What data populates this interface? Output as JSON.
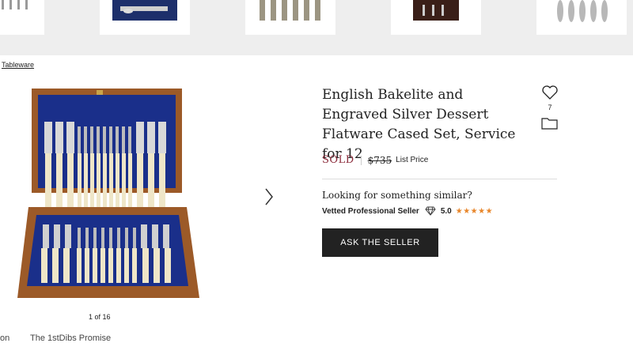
{
  "breadcrumb": "Tableware",
  "product": {
    "title": "English Bakelite and Engraved Silver Dessert Flatware Cased Set, Service for 12",
    "status": "SOLD",
    "price": "$735",
    "price_label": "List Price"
  },
  "favorites": {
    "count": "7"
  },
  "gallery": {
    "counter": "1 of 16"
  },
  "similar": {
    "prompt": "Looking for something similar?"
  },
  "seller": {
    "label": "Vetted Professional Seller",
    "rating": "5.0",
    "stars": "★★★★★"
  },
  "actions": {
    "ask_label": "ASK THE SELLER"
  },
  "footer": {
    "left_label": "on",
    "promise_label": "The 1stDibs Promise"
  },
  "colors": {
    "sold": "#8b2a3a",
    "star": "#e8862a",
    "button": "#222222"
  }
}
